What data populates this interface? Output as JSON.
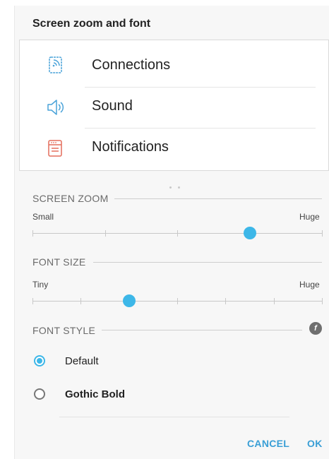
{
  "dialog": {
    "title": "Screen zoom and font"
  },
  "preview": {
    "items": [
      {
        "label": "Connections",
        "icon": "connections-icon"
      },
      {
        "label": "Sound",
        "icon": "sound-icon"
      },
      {
        "label": "Notifications",
        "icon": "notifications-icon"
      }
    ],
    "page_indicator_count": 2
  },
  "screen_zoom": {
    "header": "SCREEN ZOOM",
    "min_label": "Small",
    "max_label": "Huge",
    "steps": 4,
    "value_step": 3
  },
  "font_size": {
    "header": "FONT SIZE",
    "min_label": "Tiny",
    "max_label": "Huge",
    "steps": 6,
    "value_step": 2
  },
  "font_style": {
    "header": "FONT STYLE",
    "download_icon": "font-download-icon",
    "options": [
      {
        "label": "Default",
        "selected": true
      },
      {
        "label": "Gothic Bold",
        "selected": false
      }
    ]
  },
  "buttons": {
    "cancel": "CANCEL",
    "ok": "OK"
  },
  "colors": {
    "accent": "#3db7e8",
    "button_text": "#3a9fd6",
    "notification_icon": "#e46d5c",
    "connection_icon": "#4aa3d9"
  }
}
